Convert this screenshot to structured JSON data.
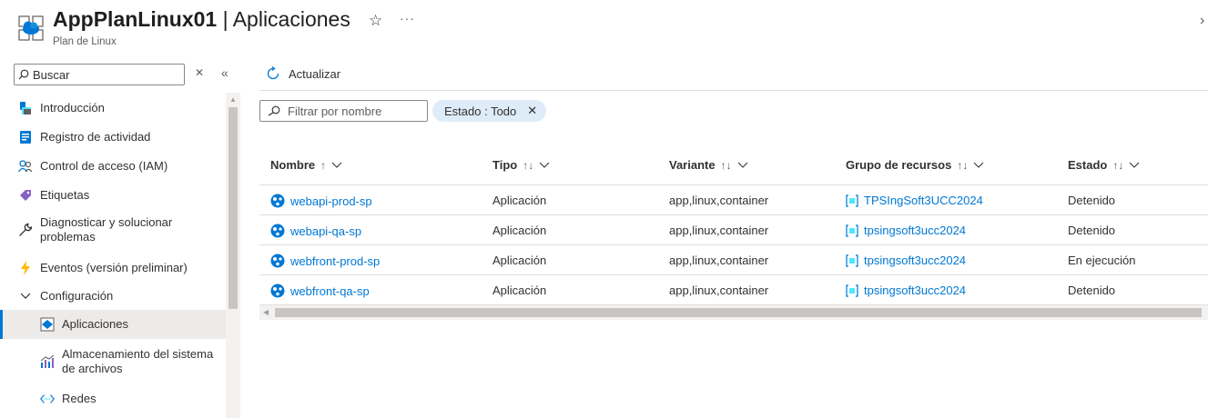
{
  "header": {
    "resource_name": "AppPlanLinux01",
    "separator": " | ",
    "page_title": "Aplicaciones",
    "subtitle": "Plan de Linux",
    "star_glyph": "☆",
    "more_glyph": "···",
    "close_glyph": "›"
  },
  "sidebar": {
    "search_placeholder": "Buscar",
    "clear_glyph": "✕",
    "collapse_glyph": "«",
    "items": [
      {
        "label": "Introducción",
        "icon": "overview-icon"
      },
      {
        "label": "Registro de actividad",
        "icon": "activity-log-icon"
      },
      {
        "label": "Control de acceso (IAM)",
        "icon": "iam-icon"
      },
      {
        "label": "Etiquetas",
        "icon": "tag-icon"
      },
      {
        "label": "Diagnosticar y solucionar problemas",
        "icon": "wrench-icon"
      },
      {
        "label": "Eventos (versión preliminar)",
        "icon": "lightning-icon"
      },
      {
        "label": "Configuración",
        "icon": "chevron-down-icon"
      },
      {
        "label": "Aplicaciones",
        "icon": "apps-icon",
        "active": true
      },
      {
        "label": "Almacenamiento del sistema de archivos",
        "icon": "storage-chart-icon"
      },
      {
        "label": "Redes",
        "icon": "network-icon"
      }
    ]
  },
  "toolbar": {
    "refresh_label": "Actualizar"
  },
  "filters": {
    "name_placeholder": "Filtrar por nombre",
    "status_pill": "Estado : Todo"
  },
  "table": {
    "columns": [
      {
        "label": "Nombre",
        "sort": "↑"
      },
      {
        "label": "Tipo",
        "sort": "↑↓"
      },
      {
        "label": "Variante",
        "sort": "↑↓"
      },
      {
        "label": "Grupo de recursos",
        "sort": "↑↓"
      },
      {
        "label": "Estado",
        "sort": "↑↓"
      }
    ],
    "rows": [
      {
        "name": "webapi-prod-sp",
        "type": "Aplicación",
        "variant": "app,linux,container",
        "rg": "TPSIngSoft3UCC2024",
        "status": "Detenido"
      },
      {
        "name": "webapi-qa-sp",
        "type": "Aplicación",
        "variant": "app,linux,container",
        "rg": "tpsingsoft3ucc2024",
        "status": "Detenido"
      },
      {
        "name": "webfront-prod-sp",
        "type": "Aplicación",
        "variant": "app,linux,container",
        "rg": "tpsingsoft3ucc2024",
        "status": "En ejecución"
      },
      {
        "name": "webfront-qa-sp",
        "type": "Aplicación",
        "variant": "app,linux,container",
        "rg": "tpsingsoft3ucc2024",
        "status": "Detenido"
      }
    ]
  },
  "colors": {
    "accent": "#0078d4",
    "active_bg": "#edebe9",
    "pill_bg": "#deecf9",
    "border": "#e1dfdd"
  }
}
